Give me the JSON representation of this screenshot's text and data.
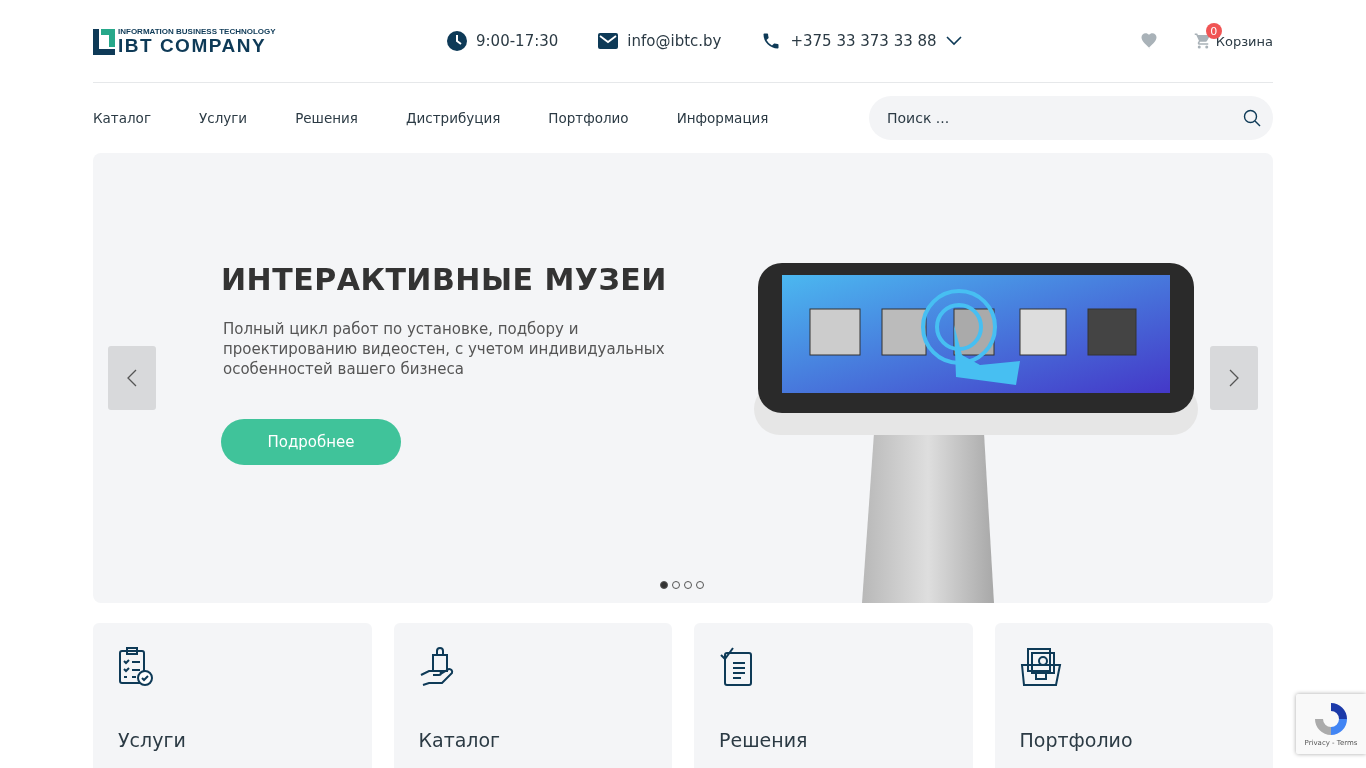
{
  "logo": {
    "tagline": "INFORMATION BUSINESS TECHNOLOGY",
    "name": "IBT COMPANY"
  },
  "contacts": [
    {
      "kind": "clock",
      "text": "9:00-17:30"
    },
    {
      "kind": "mail",
      "text": "info@ibtc.by"
    },
    {
      "kind": "phone",
      "text": "+375 33 373 33 88"
    }
  ],
  "cart": {
    "count": "0",
    "label": "Корзина"
  },
  "nav": [
    "Каталог",
    "Услуги",
    "Решения",
    "Дистрибуция",
    "Портфолио",
    "Информация"
  ],
  "search": {
    "placeholder": "Поиск ..."
  },
  "hero": {
    "title": "ИНТЕРАКТИВНЫЕ МУЗЕИ",
    "text": "Полный цикл работ по установке, подбору и проектированию видеостен, с учетом индивидуальных особенностей вашего бизнеса",
    "button": "Подробнее",
    "dots": [
      {
        "selected": true
      },
      {
        "selected": false
      },
      {
        "selected": false
      },
      {
        "selected": false
      }
    ]
  },
  "cards": [
    {
      "kind": "checklist",
      "title": "Услуги"
    },
    {
      "kind": "bag",
      "title": "Каталог"
    },
    {
      "kind": "document",
      "title": "Решения"
    },
    {
      "kind": "folder",
      "title": "Портфолио"
    }
  ],
  "recaptcha": {
    "links": "Privacy - Terms"
  }
}
